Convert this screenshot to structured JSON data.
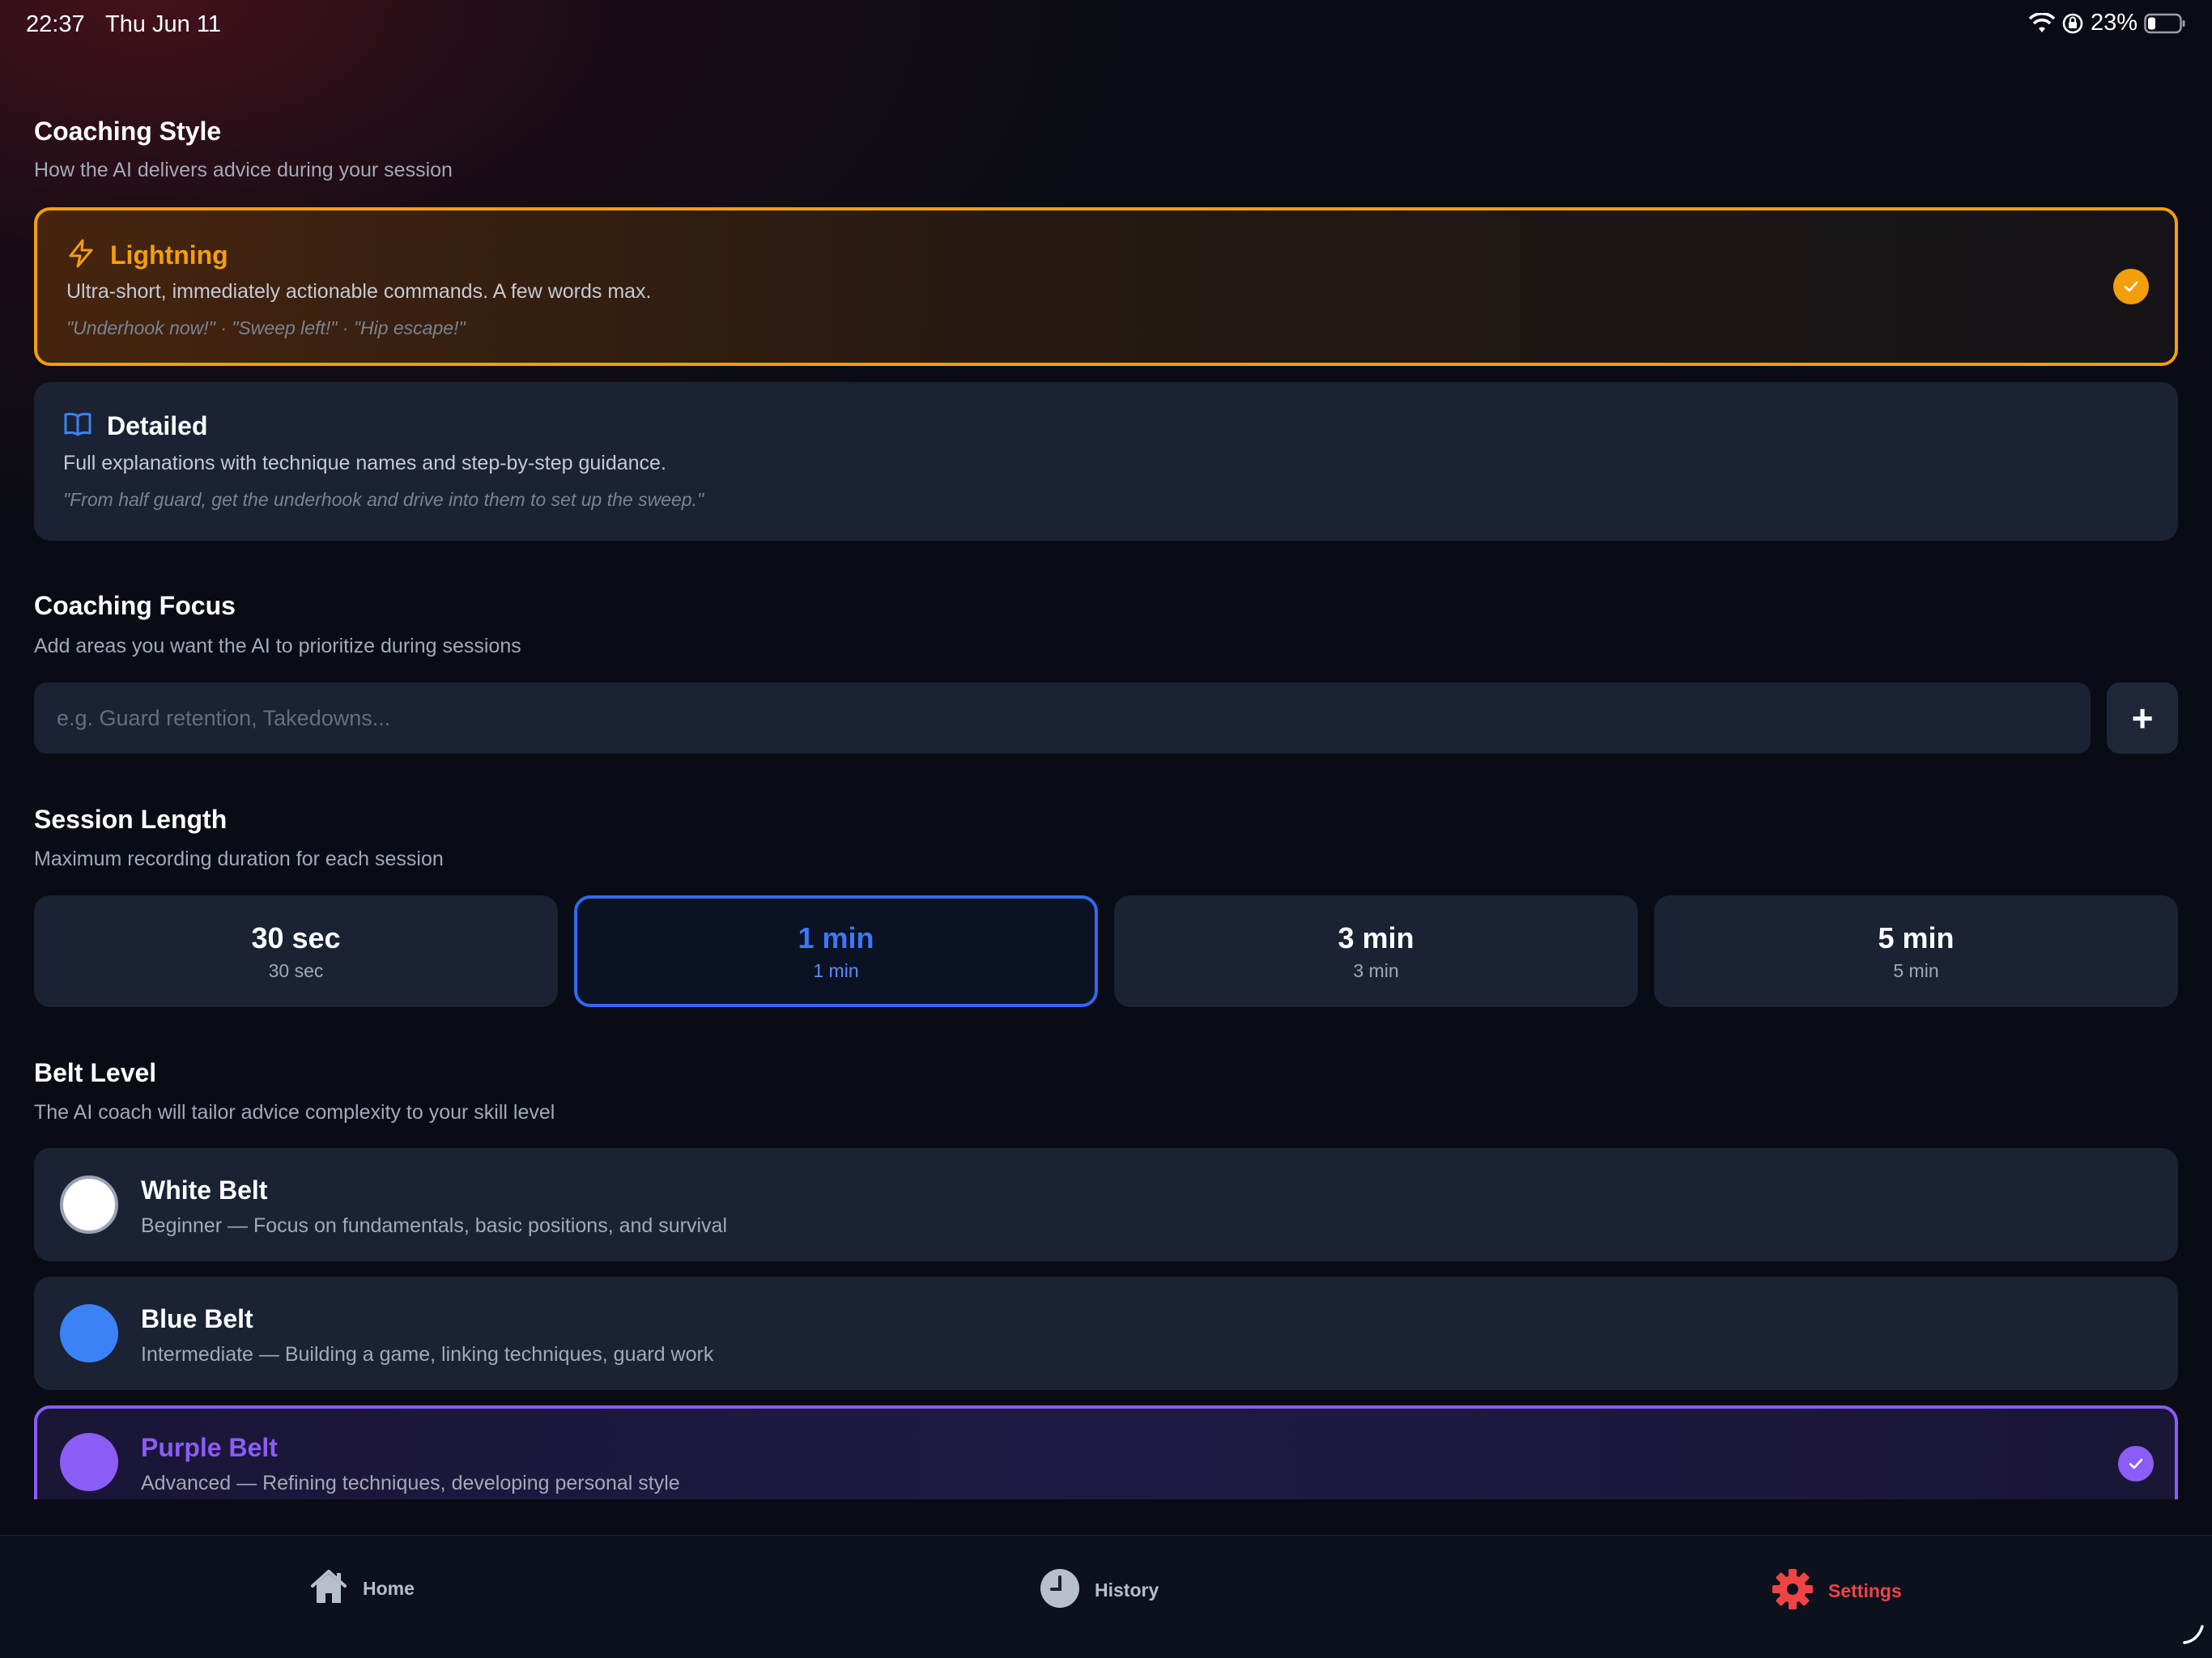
{
  "status_bar": {
    "time": "22:37",
    "date": "Thu Jun 11",
    "battery": "23%"
  },
  "coaching_style": {
    "title": "Coaching Style",
    "subtitle": "How the AI delivers advice during your session",
    "options": [
      {
        "name": "Lightning",
        "icon": "lightning-icon",
        "description": "Ultra-short, immediately actionable commands. A few words max.",
        "example": "\"Underhook now!\" · \"Sweep left!\" · \"Hip escape!\"",
        "selected": true
      },
      {
        "name": "Detailed",
        "icon": "book-open-icon",
        "description": "Full explanations with technique names and step-by-step guidance.",
        "example": "\"From half guard, get the underhook and drive into them to set up the sweep.\"",
        "selected": false
      }
    ]
  },
  "coaching_focus": {
    "title": "Coaching Focus",
    "subtitle": "Add areas you want the AI to prioritize during sessions",
    "placeholder": "e.g. Guard retention, Takedowns...",
    "add_label": "+"
  },
  "session_length": {
    "title": "Session Length",
    "subtitle": "Maximum recording duration for each session",
    "options": [
      {
        "label": "30 sec",
        "sub": "30 sec",
        "selected": false
      },
      {
        "label": "1 min",
        "sub": "1 min",
        "selected": true
      },
      {
        "label": "3 min",
        "sub": "3 min",
        "selected": false
      },
      {
        "label": "5 min",
        "sub": "5 min",
        "selected": false
      }
    ]
  },
  "belt_level": {
    "title": "Belt Level",
    "subtitle": "The AI coach will tailor advice complexity to your skill level",
    "options": [
      {
        "name": "White Belt",
        "description": "Beginner — Focus on fundamentals, basic positions, and survival",
        "color": "#ffffff",
        "selected": false
      },
      {
        "name": "Blue Belt",
        "description": "Intermediate — Building a game, linking techniques, guard work",
        "color": "#3b82f6",
        "selected": false
      },
      {
        "name": "Purple Belt",
        "description": "Advanced — Refining techniques, developing personal style",
        "color": "#8b5cf6",
        "selected": true
      }
    ]
  },
  "tab_bar": {
    "tabs": [
      {
        "label": "Home",
        "icon": "home-icon",
        "active": false
      },
      {
        "label": "History",
        "icon": "clock-icon",
        "active": false
      },
      {
        "label": "Settings",
        "icon": "gear-icon",
        "active": true
      }
    ]
  },
  "colors": {
    "accent_orange": "#f59e0b",
    "accent_blue": "#2f6bf2",
    "accent_purple": "#8b5cf6",
    "accent_red": "#ef4444"
  }
}
